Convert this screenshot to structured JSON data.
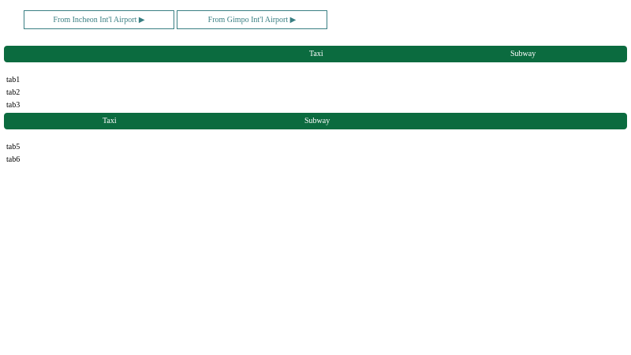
{
  "airport_buttons": {
    "incheon": "From Incheon Int'l Airport ▶",
    "gimpo": "From Gimpo Int'l Airport ▶"
  },
  "tabbar_1": {
    "taxi": "Taxi",
    "subway": "Subway"
  },
  "list_1": [
    "tab1",
    "tab2",
    "tab3"
  ],
  "tabbar_2": {
    "taxi": "Taxi",
    "subway": "Subway"
  },
  "list_2": [
    "tab5",
    "tab6"
  ],
  "colors": {
    "accent_green": "#0b6b3f",
    "button_teal": "#3a7f83"
  }
}
